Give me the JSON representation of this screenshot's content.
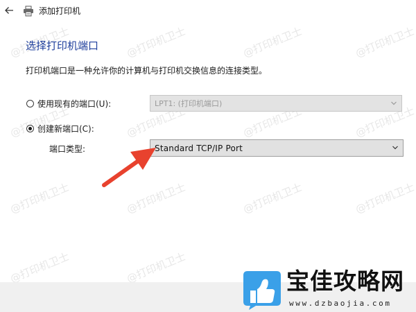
{
  "window": {
    "title": "添加打印机"
  },
  "page": {
    "heading": "选择打印机端口",
    "description": "打印机端口是一种允许你的计算机与打印机交换信息的连接类型。"
  },
  "options": {
    "use_existing": {
      "label": "使用现有的端口(U):",
      "selected": false,
      "value": "LPT1: (打印机端口)"
    },
    "create_new": {
      "label": "创建新端口(C):",
      "selected": true,
      "type_label": "端口类型:",
      "type_value": "Standard TCP/IP Port"
    }
  },
  "watermark": {
    "text": "@打印机卫士"
  },
  "brand": {
    "name": "宝佳攻略网",
    "url": "www.dzbaojia.com",
    "logo_color": "#3aa0e8"
  },
  "colors": {
    "heading": "#1f3f9c",
    "arrow": "#e8422e",
    "footer": "#f0f0f0"
  },
  "icons": {
    "back": "back-arrow-icon",
    "printer": "printer-icon",
    "dropdown": "chevron-down-icon"
  }
}
